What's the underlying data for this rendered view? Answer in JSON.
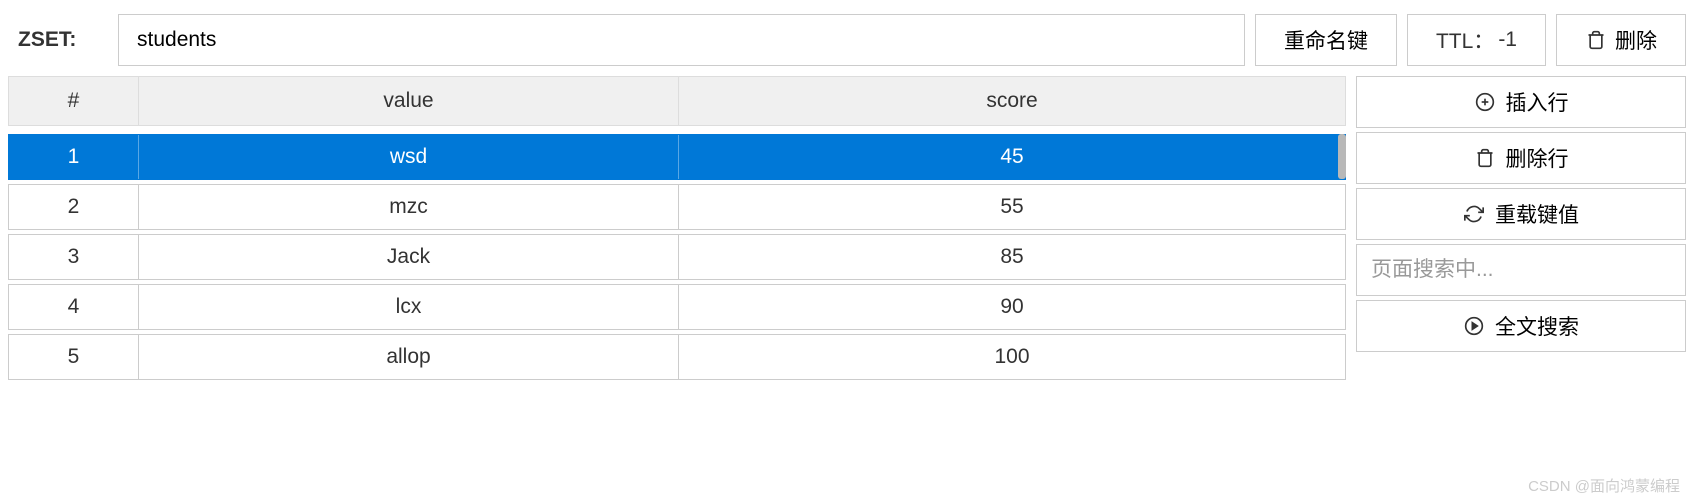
{
  "header": {
    "type_label": "ZSET:",
    "key_value": "students",
    "rename_label": "重命名键",
    "ttl_label": "TTL：",
    "ttl_value": "-1",
    "delete_label": "删除"
  },
  "table": {
    "columns": {
      "index": "#",
      "value": "value",
      "score": "score"
    },
    "rows": [
      {
        "index": "1",
        "value": "wsd",
        "score": "45",
        "selected": true
      },
      {
        "index": "2",
        "value": "mzc",
        "score": "55",
        "selected": false
      },
      {
        "index": "3",
        "value": "Jack",
        "score": "85",
        "selected": false
      },
      {
        "index": "4",
        "value": "lcx",
        "score": "90",
        "selected": false
      },
      {
        "index": "5",
        "value": "allop",
        "score": "100",
        "selected": false
      }
    ]
  },
  "side": {
    "insert_row": "插入行",
    "delete_row": "删除行",
    "reload": "重载键值",
    "search_placeholder": "页面搜索中...",
    "fulltext_search": "全文搜索"
  },
  "watermark": "CSDN @面向鸿蒙编程"
}
